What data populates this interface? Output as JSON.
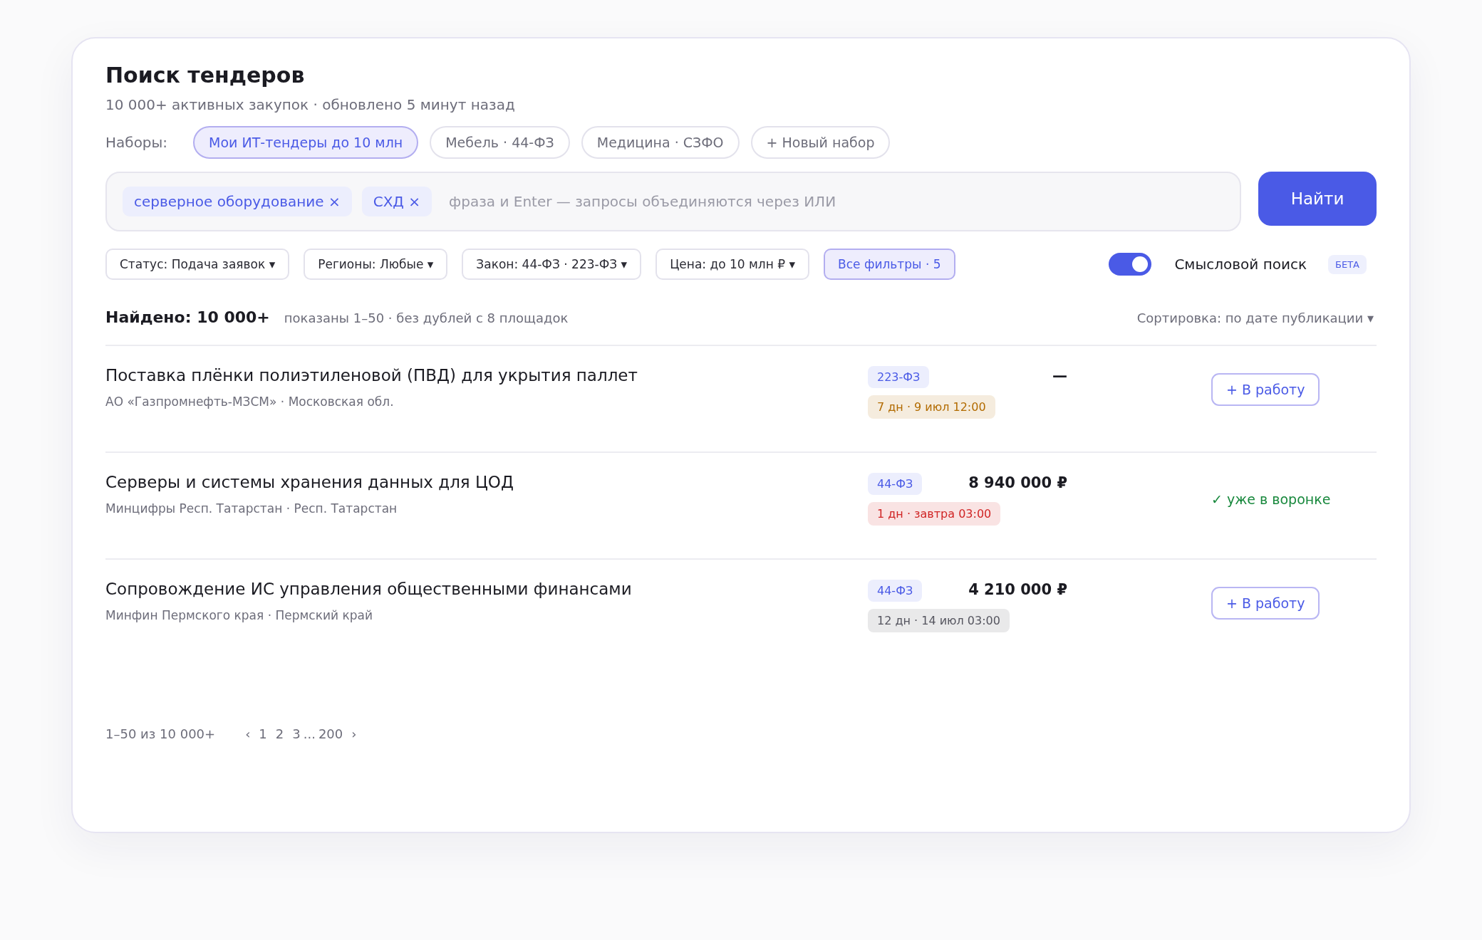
{
  "header": {
    "title": "Поиск тендеров",
    "subtitle": "10 000+ активных закупок · обновлено 5 минут назад"
  },
  "sets": {
    "label": "Наборы:",
    "items": [
      {
        "label": "Мои ИТ-тендеры до 10 млн",
        "selected": true
      },
      {
        "label": "Мебель · 44-ФЗ",
        "selected": false
      },
      {
        "label": "Медицина · СЗФО",
        "selected": false
      },
      {
        "label": "+ Новый набор",
        "selected": false
      }
    ]
  },
  "search": {
    "tokens": [
      "серверное оборудование ×",
      "СХД ×"
    ],
    "placeholder": "фраза и Enter — запросы объединяются через ИЛИ",
    "button": "Найти"
  },
  "filters": [
    {
      "label": "Статус: Подача заявок ▾",
      "active": false
    },
    {
      "label": "Регионы: Любые ▾",
      "active": false
    },
    {
      "label": "Закон: 44-ФЗ · 223-ФЗ ▾",
      "active": false
    },
    {
      "label": "Цена: до 10 млн ₽ ▾",
      "active": false
    },
    {
      "label": "Все фильтры · 5",
      "active": true
    }
  ],
  "semantic_search": {
    "on": true,
    "label": "Смысловой поиск",
    "badge": "БЕТА"
  },
  "results": {
    "found": "Найдено: 10 000+",
    "note": "показаны 1–50 · без дублей с 8 площадок",
    "sort": "Сортировка: по дате публикации ▾"
  },
  "tenders": [
    {
      "title": "Поставка плёнки полиэтиленовой (ПВД) для укрытия паллет",
      "customer": "АО «Газпромнефть-МЗСМ» · Московская обл.",
      "law": "223-ФЗ",
      "price": "—",
      "deadline": "7 дн · 9 июл 12:00",
      "color": "#b26b00",
      "action": {
        "kind": "button",
        "label": "+ В работу"
      }
    },
    {
      "title": "Серверы и системы хранения данных для ЦОД",
      "customer": "Минцифры Респ. Татарстан · Респ. Татарстан",
      "law": "44-ФЗ",
      "price": "8 940 000 ₽",
      "deadline": "1 дн · завтра 03:00",
      "color": "#d02525",
      "action": {
        "kind": "status",
        "label": "✓ уже в воронке"
      }
    },
    {
      "title": "Сопровождение ИС управления общественными финансами",
      "customer": "Минфин Пермского края · Пермский край",
      "law": "44-ФЗ",
      "price": "4 210 000 ₽",
      "deadline": "12 дн · 14 июл 03:00",
      "color": "#55555f",
      "action": {
        "kind": "button",
        "label": "+ В работу"
      }
    }
  ],
  "pagination": {
    "range": "1–50 из 10 000+",
    "prev": "‹",
    "pages": [
      "1",
      "2",
      "3"
    ],
    "ellipsis": "...",
    "last": "200",
    "next": "›"
  }
}
